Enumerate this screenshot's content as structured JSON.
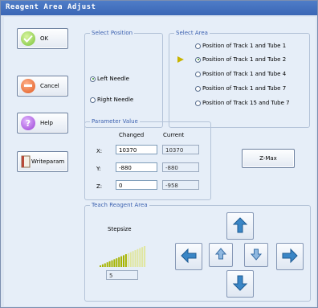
{
  "window": {
    "title": "Reagent Area Adjust"
  },
  "buttons": {
    "ok": "OK",
    "cancel": "Cancel",
    "help": "Help",
    "writeparam": "Writeparam",
    "zmax": "Z-Max"
  },
  "select_position": {
    "title": "Select Position",
    "options": [
      "Left Needle",
      "Right Needle"
    ],
    "selected": "Left Needle"
  },
  "select_area": {
    "title": "Select Area",
    "options": [
      "Position of Track 1 and Tube 1",
      "Position of Track 1 and Tube 2",
      "Position of Track 1 and Tube 4",
      "Position of Track 1 and Tube 7",
      "Position of Track 15 and Tube 7"
    ],
    "selected": "Position of Track 1 and Tube 2"
  },
  "parameter_value": {
    "title": "Parameter Value",
    "col_changed": "Changed",
    "col_current": "Current",
    "rows": [
      {
        "axis": "X:",
        "changed": "10370",
        "current": "10370"
      },
      {
        "axis": "Y:",
        "changed": "-880",
        "current": "-880"
      },
      {
        "axis": "Z:",
        "changed": "0",
        "current": "-958"
      }
    ]
  },
  "teach": {
    "title": "Teach Reagent Area",
    "stepsize_label": "Stepsize",
    "stepsize_value": "5",
    "stepsize_level": 0.6
  },
  "colors": {
    "accent_title": "#3d62b0",
    "arrow_blue": "#3a86c6",
    "stepsize_bars": "#a6b400"
  },
  "icons": {
    "ok": "check-icon",
    "cancel": "minus-icon",
    "help": "question-icon",
    "writeparam": "document-icon"
  }
}
